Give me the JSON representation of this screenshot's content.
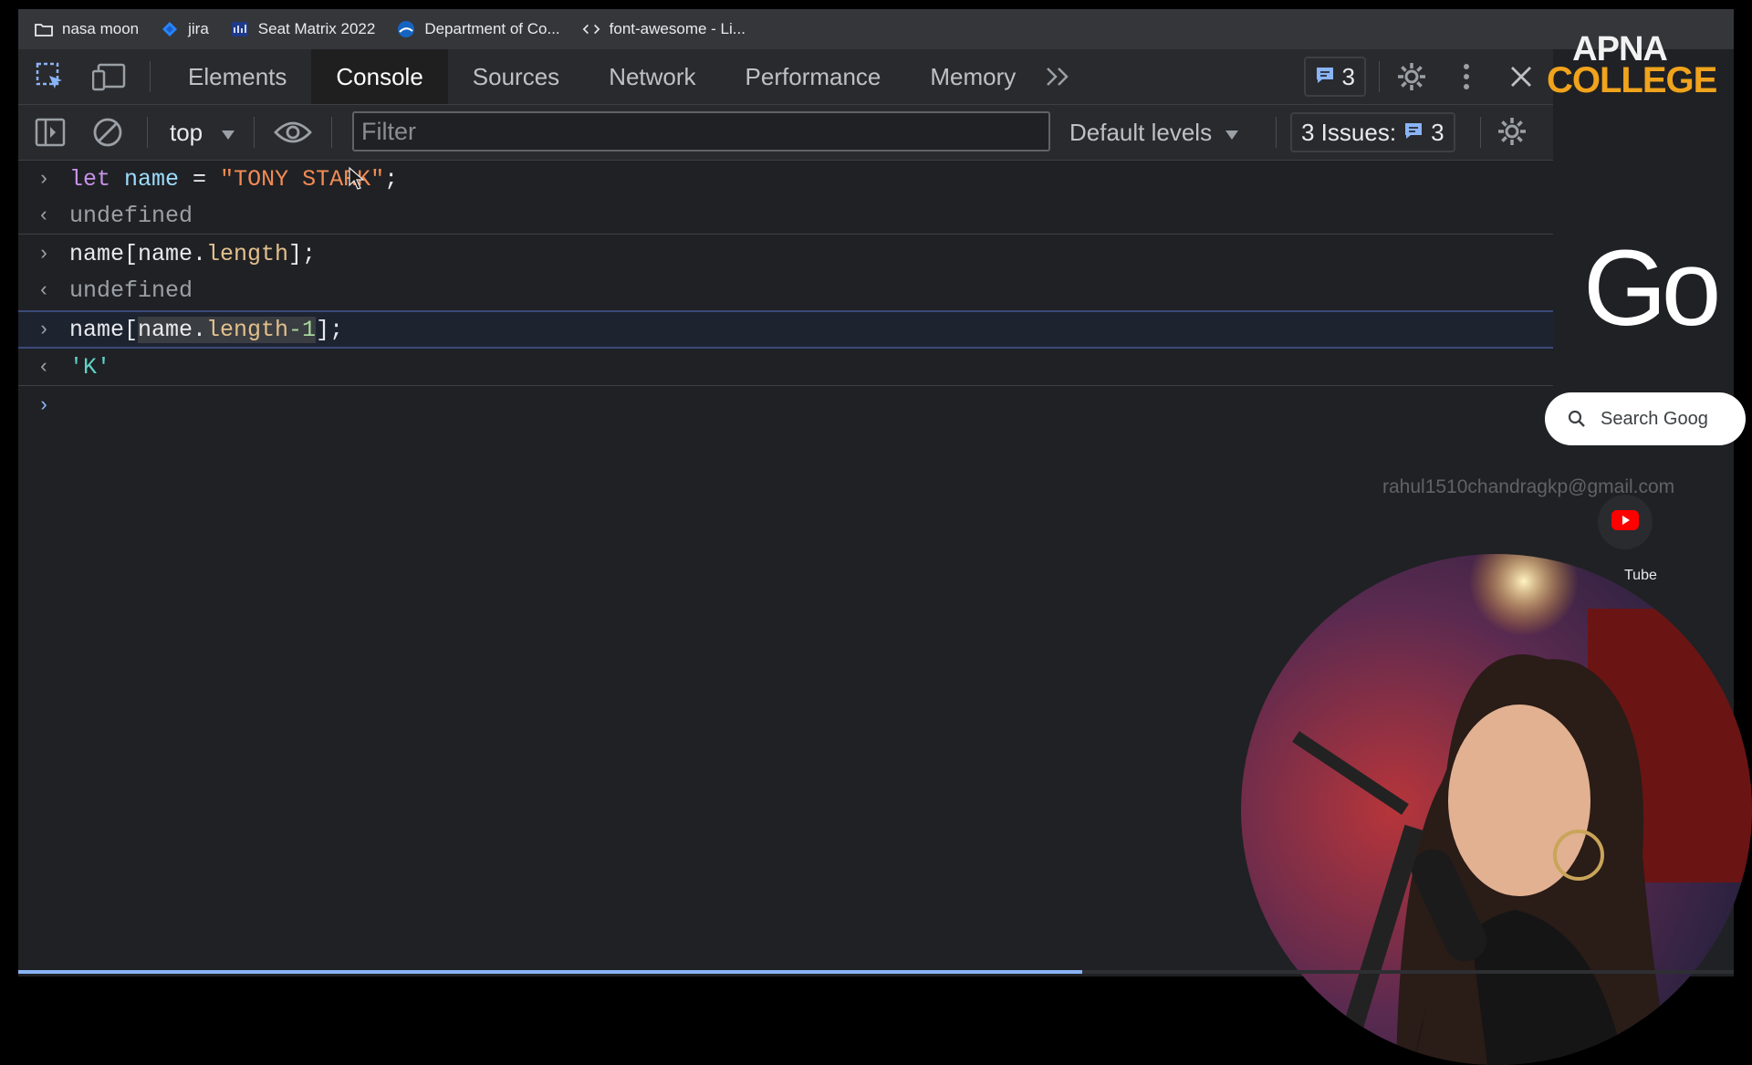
{
  "bookmarks": [
    {
      "label": "nasa moon",
      "icon": "folder-icon"
    },
    {
      "label": "jira",
      "icon": "jira-icon"
    },
    {
      "label": "Seat Matrix 2022",
      "icon": "seat-matrix-icon"
    },
    {
      "label": "Department of Co...",
      "icon": "department-icon"
    },
    {
      "label": "font-awesome - Li...",
      "icon": "code-icon"
    }
  ],
  "devtools": {
    "tabs": [
      "Elements",
      "Console",
      "Sources",
      "Network",
      "Performance",
      "Memory"
    ],
    "active_tab": "Console",
    "messages_count": "3",
    "toolbar": {
      "context": "top",
      "filter_placeholder": "Filter",
      "levels": "Default levels",
      "issues_label": "3 Issues:",
      "issues_count": "3"
    }
  },
  "console": {
    "line1": {
      "kw": "let",
      "var": "name",
      "op": " = ",
      "str": "\"TONY STARK\"",
      "end": ";"
    },
    "out1": "undefined",
    "line2": {
      "a": "name[",
      "b": "name.",
      "c": "length",
      "d": "];"
    },
    "out2": "undefined",
    "line3": {
      "a": "name[",
      "b": "name.",
      "c": "length",
      "d": "-1",
      "e": "];"
    },
    "out3": "'K'"
  },
  "sidebar": {
    "logo_line1": "APNA",
    "logo_line2": "COLLEGE",
    "google_text": "Go",
    "search_placeholder": "Search Goog",
    "email": "rahul1510chandragkp@gmail.com",
    "youtube_label": "Tube"
  },
  "playback": {
    "progress": 0.62
  },
  "colors": {
    "accent": "#8ab4f8",
    "string": "#f28b54",
    "logo_orange": "#f0a31c"
  }
}
